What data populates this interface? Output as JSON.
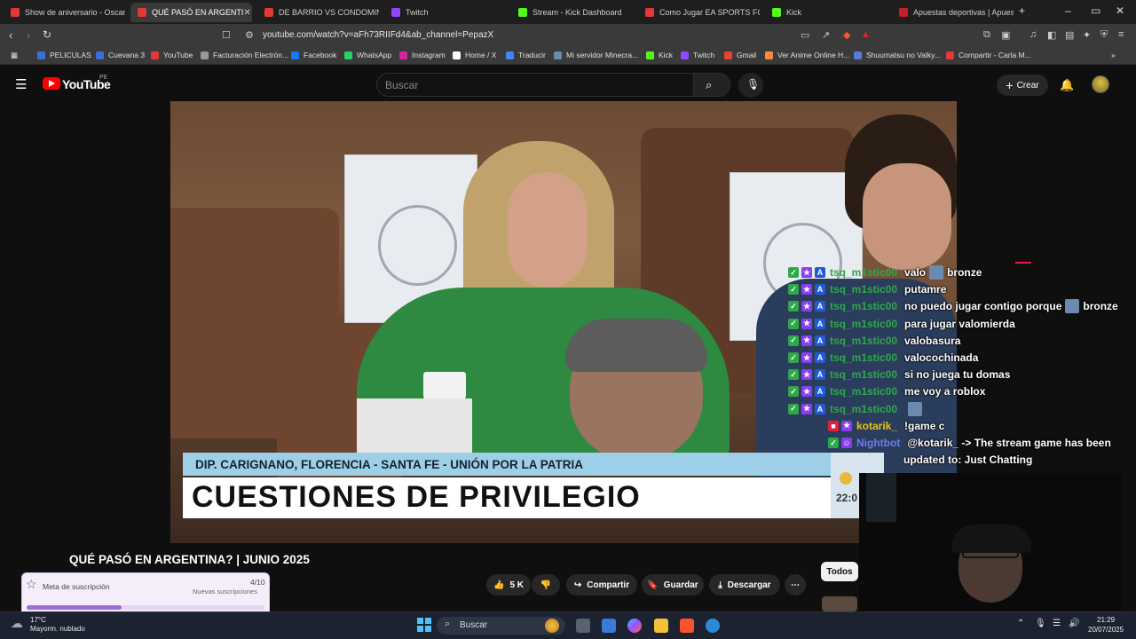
{
  "browser": {
    "tabs": [
      {
        "label": "Show de aniversario - Oscar Ti",
        "favicon_color": "#e23838",
        "active": false
      },
      {
        "label": "QUÉ PASÓ EN ARGENTI",
        "favicon_color": "#e23838",
        "active": true
      },
      {
        "label": "DE BARRIO VS CONDOMINIO",
        "favicon_color": "#e23838",
        "active": false
      },
      {
        "label": "Twitch",
        "favicon_color": "#9146ff",
        "active": false
      },
      {
        "label": "Stream - Kick Dashboard",
        "favicon_color": "#53fc18",
        "active": false
      },
      {
        "label": "Como Jugar EA SPORTS FC 25",
        "favicon_color": "#e23838",
        "active": false
      },
      {
        "label": "Kick",
        "favicon_color": "#53fc18",
        "active": false
      },
      {
        "label": "Apuestas deportivas | Apuesta",
        "favicon_color": "#c81e2a",
        "active": false
      }
    ],
    "new_tab": "+",
    "url": "youtube.com/watch?v=aFh73RIIFd4&ab_channel=PepazX",
    "bookmarks": [
      {
        "label": "PELICULAS",
        "color": "#3b6fd8"
      },
      {
        "label": "Cuevana 3",
        "color": "#3b6fd8"
      },
      {
        "label": "YouTube",
        "color": "#e23838"
      },
      {
        "label": "Facturación Electrón...",
        "color": "#999999"
      },
      {
        "label": "Facebook",
        "color": "#1877f2"
      },
      {
        "label": "WhatsApp",
        "color": "#25d366"
      },
      {
        "label": "Instagram",
        "color": "#d6249f"
      },
      {
        "label": "Home / X",
        "color": "#ffffff"
      },
      {
        "label": "Traducir",
        "color": "#4285f4"
      },
      {
        "label": "Mi servidor Minecra...",
        "color": "#6a8ab0"
      },
      {
        "label": "Kick",
        "color": "#53fc18"
      },
      {
        "label": "Twitch",
        "color": "#9146ff"
      },
      {
        "label": "Gmail",
        "color": "#ea4335"
      },
      {
        "label": "Ver Anime Online H...",
        "color": "#ff8a3c"
      },
      {
        "label": "Shuumatsu no Valky...",
        "color": "#5a7ad8"
      },
      {
        "label": "Compartir - Carla M...",
        "color": "#e23838"
      }
    ]
  },
  "youtube": {
    "logo": "YouTube",
    "region": "PE",
    "search_placeholder": "Buscar",
    "create_label": "Crear",
    "video": {
      "lower_third_name": "DIP. CARIGNANO, FLORENCIA - SANTA FE - UNIÓN POR LA PATRIA",
      "lower_third_title": "CUESTIONES DE PRIVILEGIO",
      "clock": "22:0"
    },
    "title": "QUÉ PASÓ EN ARGENTINA? | JUNIO 2025",
    "likes": "5 K",
    "share_label": "Compartir",
    "save_label": "Guardar",
    "download_label": "Descargar",
    "filter_chip": "Todos"
  },
  "chat": [
    {
      "user": "tsq_m1stic00",
      "user_color": "#2ea84a",
      "message": "valo",
      "emote": true,
      "after": "bronze",
      "badges": [
        "check",
        "star",
        "a"
      ]
    },
    {
      "user": "tsq_m1stic00",
      "user_color": "#2ea84a",
      "message": "putamre",
      "badges": [
        "check",
        "star",
        "a"
      ]
    },
    {
      "user": "tsq_m1stic00",
      "user_color": "#2ea84a",
      "message": "no puedo jugar contigo porque",
      "emote": true,
      "after": "bronze",
      "badges": [
        "check",
        "star",
        "a"
      ]
    },
    {
      "user": "tsq_m1stic00",
      "user_color": "#2ea84a",
      "message": "para jugar valomierda",
      "badges": [
        "check",
        "star",
        "a"
      ]
    },
    {
      "user": "tsq_m1stic00",
      "user_color": "#2ea84a",
      "message": "valobasura",
      "badges": [
        "check",
        "star",
        "a"
      ]
    },
    {
      "user": "tsq_m1stic00",
      "user_color": "#2ea84a",
      "message": "valocochinada",
      "badges": [
        "check",
        "star",
        "a"
      ]
    },
    {
      "user": "tsq_m1stic00",
      "user_color": "#2ea84a",
      "message": "si no juega tu domas",
      "badges": [
        "check",
        "star",
        "a"
      ]
    },
    {
      "user": "tsq_m1stic00",
      "user_color": "#2ea84a",
      "message": "me voy a roblox",
      "badges": [
        "check",
        "star",
        "a"
      ]
    },
    {
      "user": "tsq_m1stic00",
      "user_color": "#2ea84a",
      "message": "",
      "emote": true,
      "badges": [
        "check",
        "star",
        "a"
      ]
    },
    {
      "user": "kotarik_",
      "user_color": "#e8c21a",
      "message": "!game c",
      "badges": [
        "cam",
        "star"
      ]
    },
    {
      "user": "Nightbot",
      "user_color": "#6a7cf0",
      "message": "@kotarik_ -> The stream game has been",
      "badges": [
        "check",
        "bot"
      ]
    },
    {
      "user": "",
      "user_color": "#ffffff",
      "message": "updated to: Just Chatting",
      "badges": []
    }
  ],
  "goal_widget": {
    "label": "Meta de suscripción",
    "count": "4/10",
    "progress": 0.4,
    "subtitle": "Nuevas suscripciones"
  },
  "taskbar": {
    "weather_temp": "17°C",
    "weather_desc": "Mayorm. nublado",
    "search": "Buscar",
    "time": "21:29",
    "date": "20/07/2025"
  }
}
